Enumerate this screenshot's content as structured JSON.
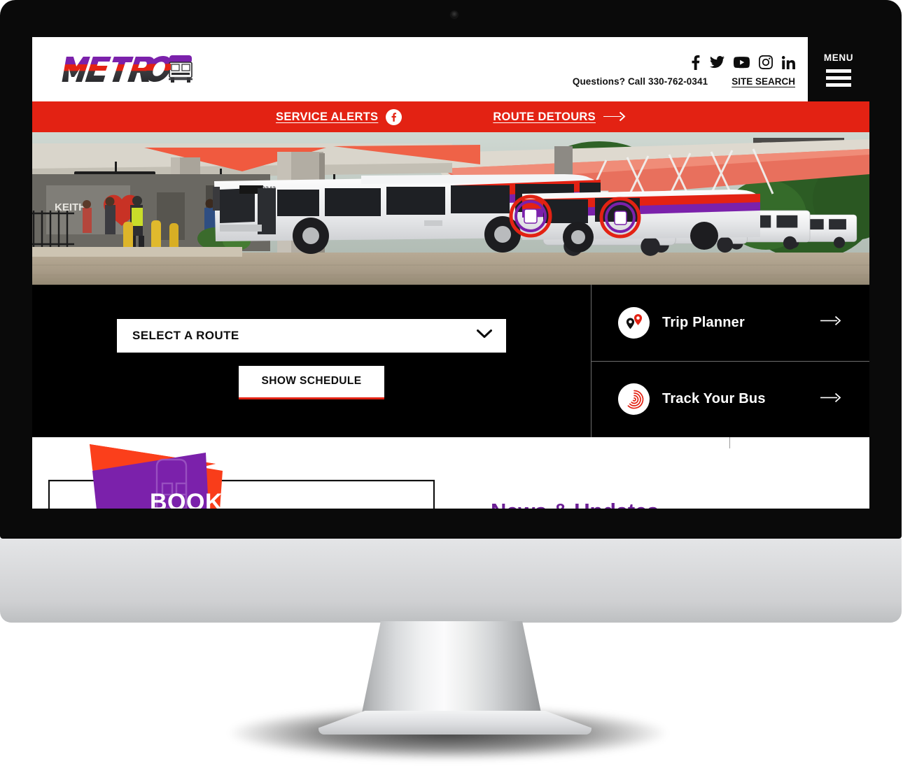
{
  "device": {
    "type": "desktop-monitor",
    "webcam": "webcam-dot"
  },
  "site": {
    "brand": {
      "logo_text": "METRO",
      "logo_icon": "bus-front-icon"
    },
    "header": {
      "social": [
        {
          "name": "facebook-icon",
          "label": "Facebook"
        },
        {
          "name": "twitter-icon",
          "label": "Twitter"
        },
        {
          "name": "youtube-icon",
          "label": "YouTube"
        },
        {
          "name": "instagram-icon",
          "label": "Instagram"
        },
        {
          "name": "linkedin-icon",
          "label": "LinkedIn"
        }
      ],
      "questions_label": "Questions?",
      "phone": "Call 330-762-0341",
      "questions_full": "Questions?  Call 330-762-0341",
      "site_search": "SITE SEARCH",
      "menu_label": "MENU",
      "menu_icon": "hamburger-icon"
    },
    "alert_bar": {
      "service_alerts": "SERVICE ALERTS",
      "service_alerts_icon": "facebook-circle-icon",
      "route_detours": "ROUTE DETOURS",
      "route_detours_icon": "arrow-right-icon"
    },
    "hero": {
      "alt": "Row of METRO buses parked at the transit center",
      "bus_number": "2343"
    },
    "quick_actions": {
      "route_select": {
        "selected": "SELECT A ROUTE",
        "chevron_icon": "chevron-down-icon"
      },
      "show_schedule": "SHOW SCHEDULE",
      "cards": [
        {
          "label": "Trip Planner",
          "icon": "map-pins-icon",
          "arrow_icon": "arrow-right-icon"
        },
        {
          "label": "Track Your Bus",
          "icon": "radar-spiral-icon",
          "arrow_icon": "arrow-right-icon"
        }
      ]
    },
    "promo": {
      "banner_text": "BOOK IT ON METRO!",
      "news_heading": "News & Updates"
    }
  },
  "colors": {
    "brand_red": "#e32213",
    "brand_purple": "#7b21ab",
    "heading_purple": "#6c1f95",
    "black": "#0a0a0a",
    "white": "#ffffff"
  }
}
